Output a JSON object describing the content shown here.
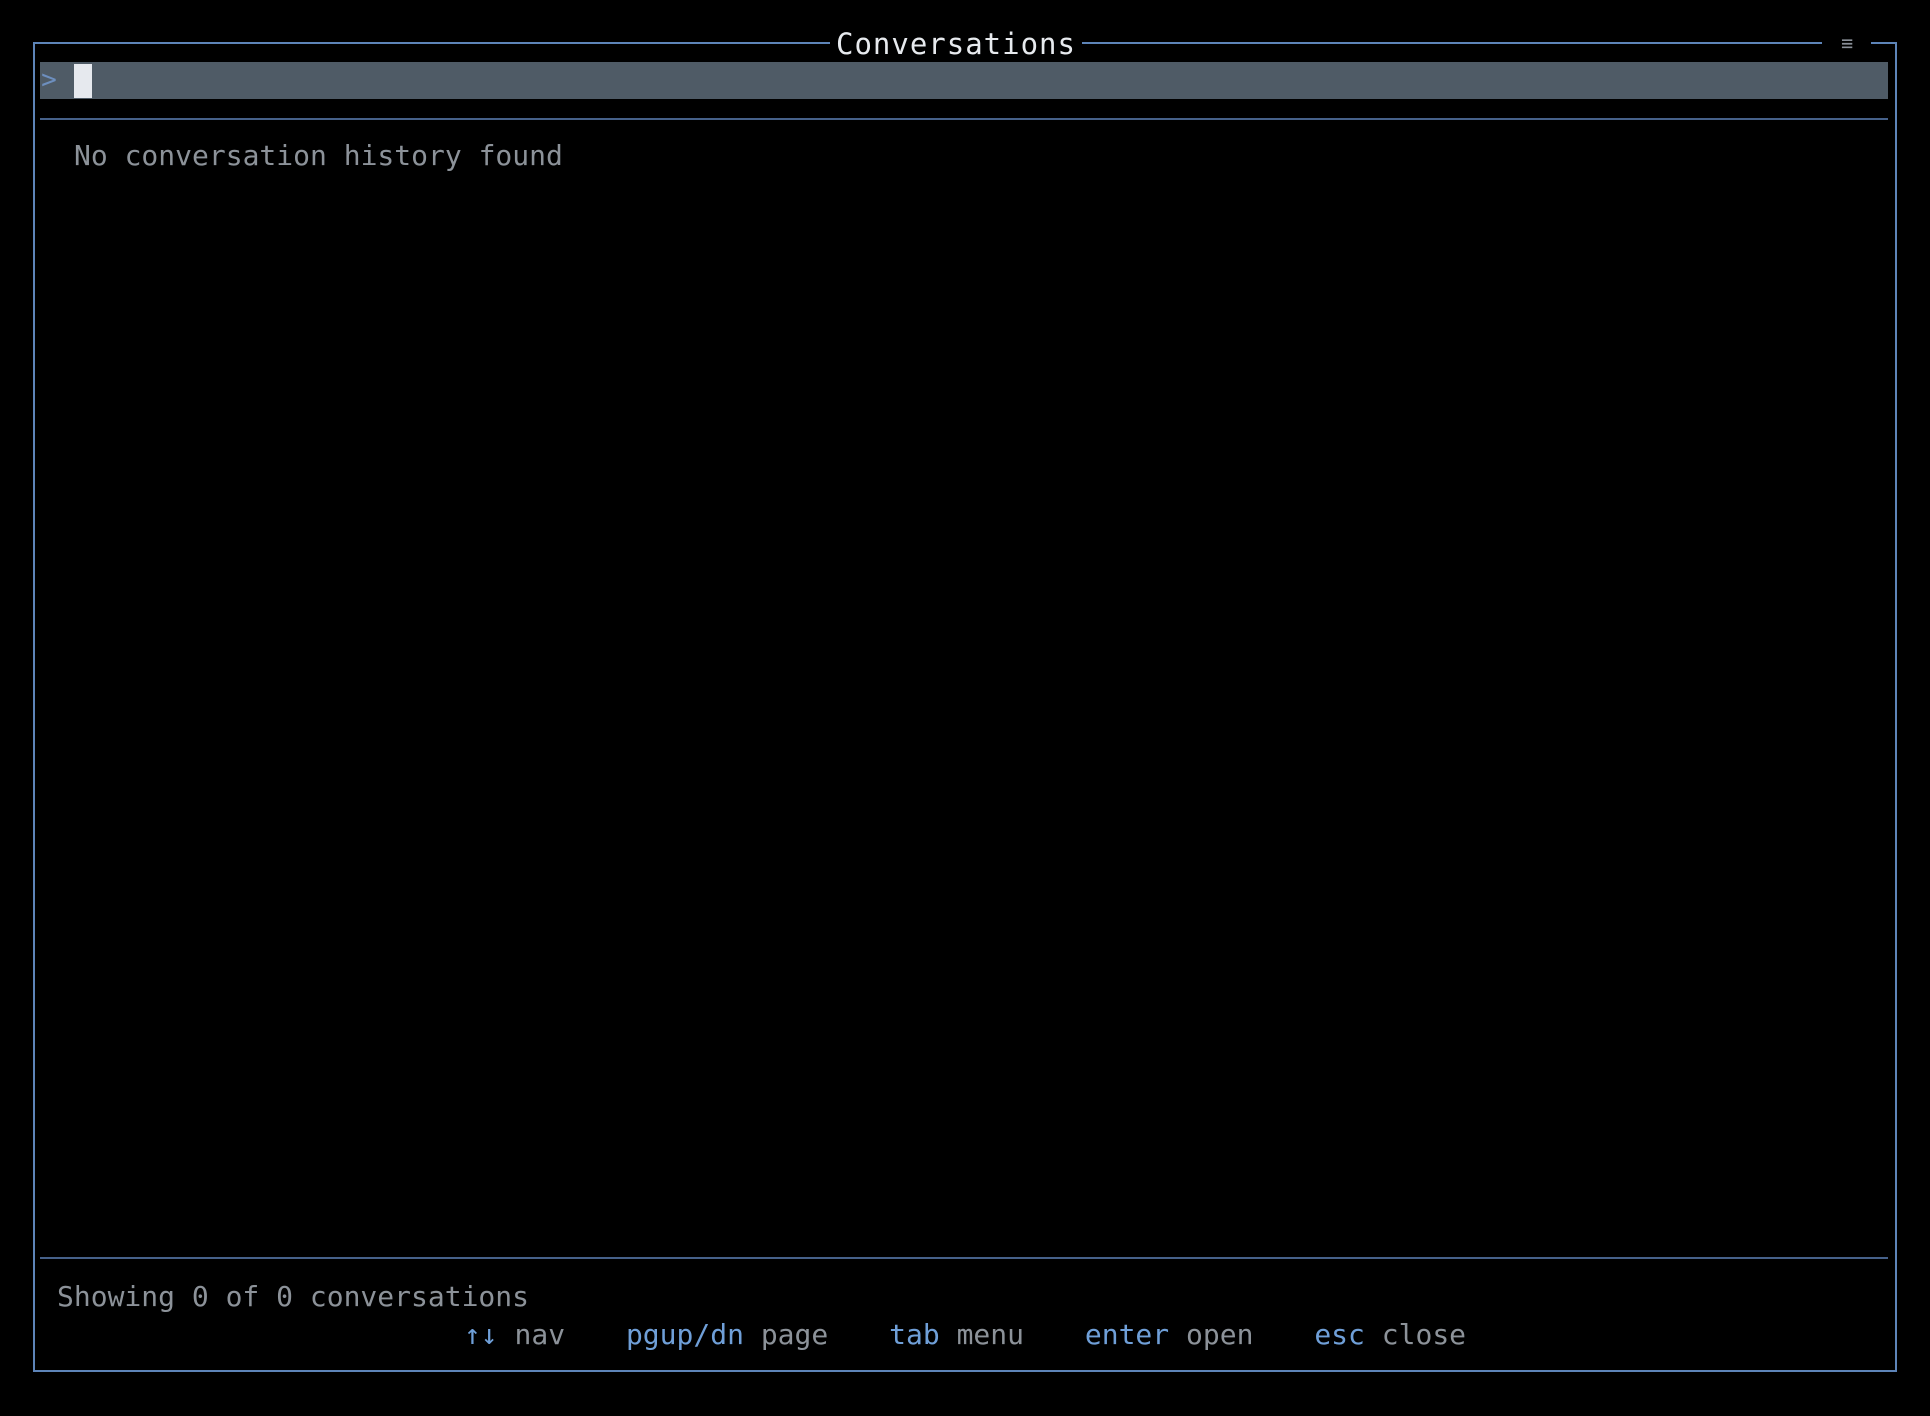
{
  "window": {
    "title": "Conversations",
    "menu_icon": "≡"
  },
  "search": {
    "prompt": ">",
    "value": "",
    "placeholder": ""
  },
  "list": {
    "empty_message": "No conversation history found"
  },
  "footer": {
    "status": "Showing 0 of 0 conversations",
    "hints": [
      {
        "key": "↑↓",
        "desc": "nav"
      },
      {
        "key": "pgup/dn",
        "desc": "page"
      },
      {
        "key": "tab",
        "desc": "menu"
      },
      {
        "key": "enter",
        "desc": "open"
      },
      {
        "key": "esc",
        "desc": "close"
      }
    ]
  },
  "colors": {
    "background": "#000000",
    "border": "#5d84b8",
    "search_bar": "#4f5b66",
    "key_accent": "#6f9fd8",
    "muted_text": "#8c9299"
  }
}
